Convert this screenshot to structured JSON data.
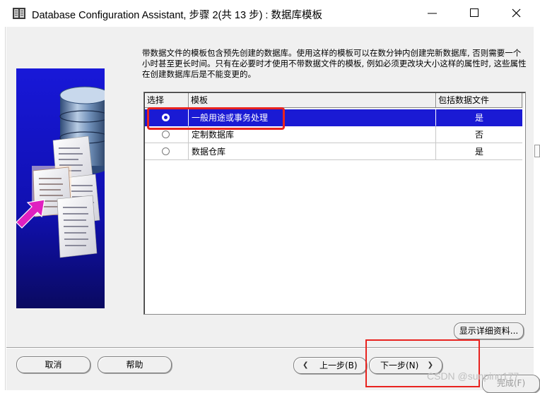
{
  "window": {
    "title": "Database Configuration Assistant, 步骤 2(共 13 步) : 数据库模板"
  },
  "description": "带数据文件的模板包含预先创建的数据库。使用这样的模板可以在数分钟内创建完新数据库, 否则需要一个小时甚至更长时间。只有在必要时才使用不带数据文件的模板, 例如必须更改块大小这样的属性时, 这些属性在创建数据库后是不能变更的。",
  "table": {
    "columns": [
      "选择",
      "模板",
      "包括数据文件"
    ],
    "rows": [
      {
        "name": "一般用途或事务处理",
        "includes_datafiles": "是",
        "selected": true
      },
      {
        "name": "定制数据库",
        "includes_datafiles": "否",
        "selected": false
      },
      {
        "name": "数据仓库",
        "includes_datafiles": "是",
        "selected": false
      }
    ]
  },
  "buttons": {
    "details": "显示详细资料...",
    "cancel": "取消",
    "help": "帮助",
    "back": "上一步(B)",
    "next": "下一步(N)",
    "finish": "完成(F)"
  },
  "watermark": "CSDN @sunping177",
  "icons": [
    "app-icon",
    "minimize-icon",
    "maximize-icon",
    "close-icon",
    "back-arrow-icon",
    "next-arrow-icon"
  ],
  "colors": {
    "selection": "#1a1ad4",
    "highlight_box": "#e8231f",
    "art_background": "#1414c8"
  }
}
